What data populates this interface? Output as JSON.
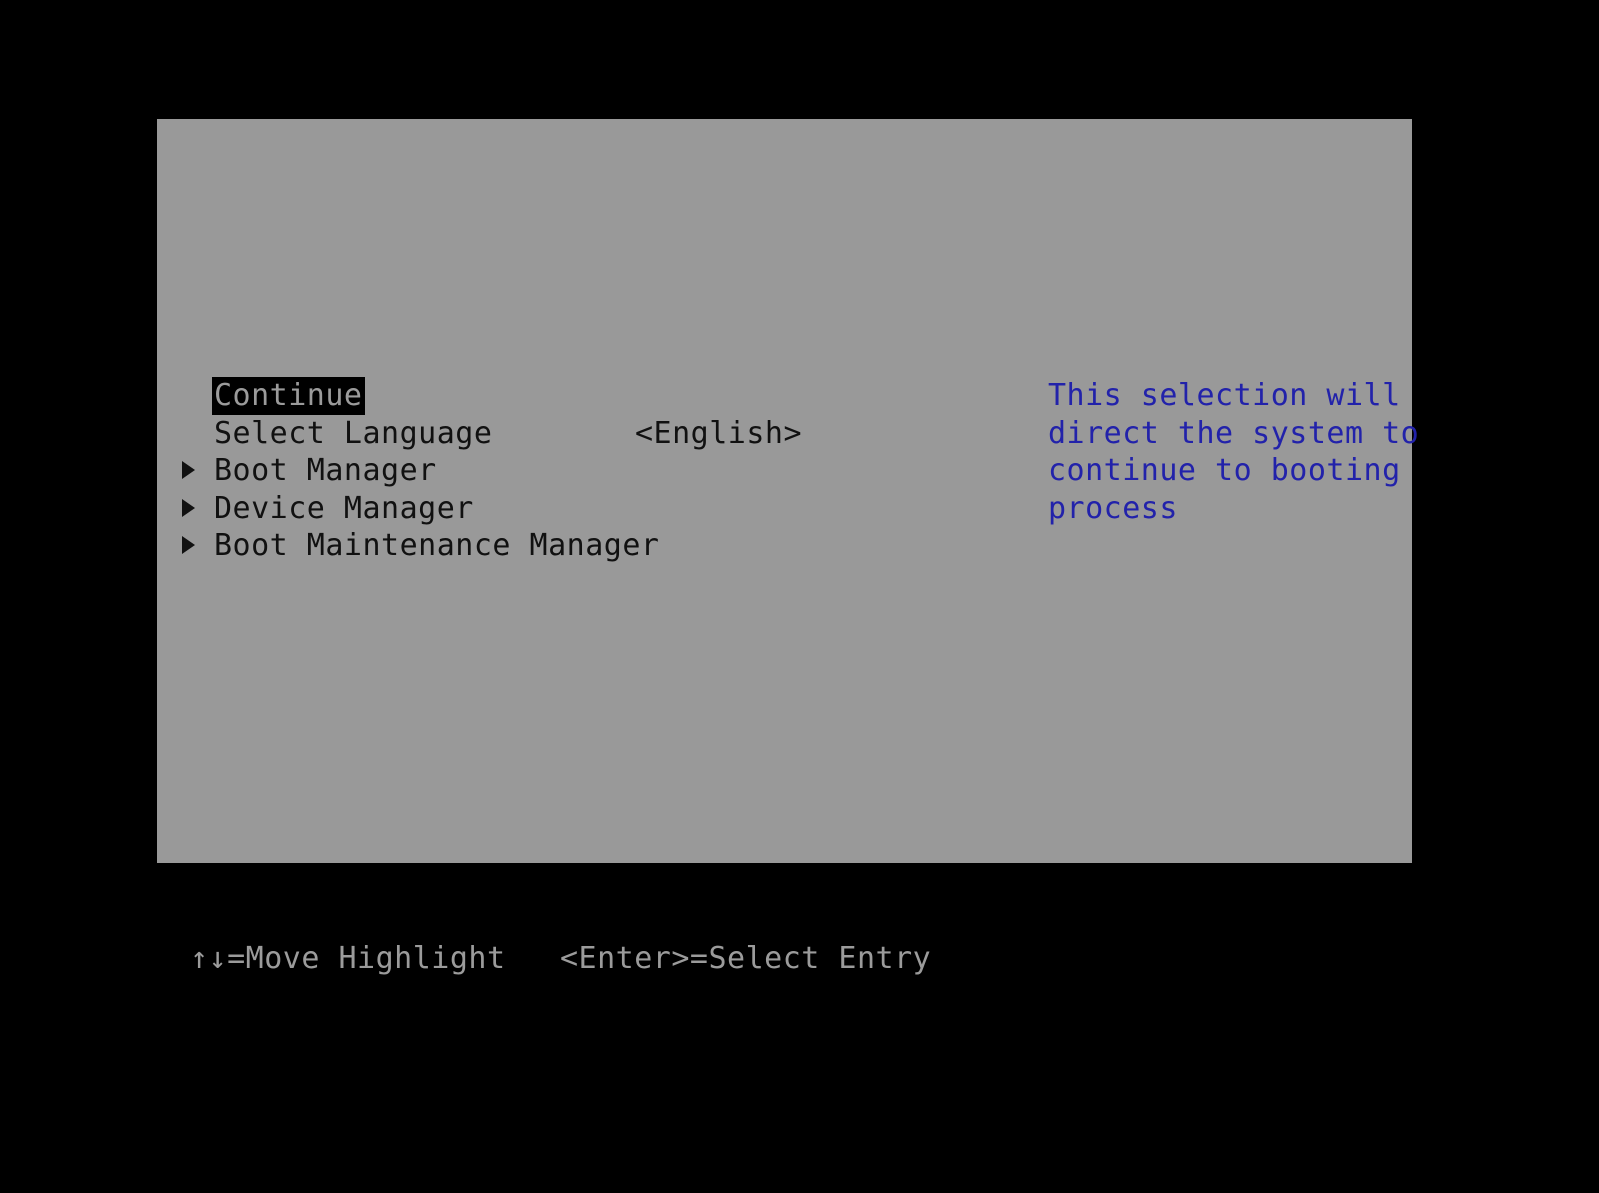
{
  "screen": {
    "kind": "uefi-setup-front-page",
    "background_color": "#000000",
    "panel_color": "#999999",
    "text_color": "#111111",
    "help_text_color": "#2222aa",
    "status_text_color": "#9b9b9b",
    "highlight_background": "#000000",
    "highlight_foreground": "#9b9b9b"
  },
  "menu": {
    "items": [
      {
        "label": "Continue",
        "value": "",
        "marker": "",
        "selected": true,
        "submenu": false
      },
      {
        "label": "Select Language",
        "value": "<English>",
        "marker": "",
        "selected": false,
        "submenu": false
      },
      {
        "label": "Boot Manager",
        "value": "",
        "marker": "submenu-triangle-icon",
        "selected": false,
        "submenu": true
      },
      {
        "label": "Device Manager",
        "value": "",
        "marker": "submenu-triangle-icon",
        "selected": false,
        "submenu": true
      },
      {
        "label": "Boot Maintenance Manager",
        "value": "",
        "marker": "submenu-triangle-icon",
        "selected": false,
        "submenu": true
      }
    ]
  },
  "help": {
    "lines": [
      "This selection will",
      "direct the system to",
      "continue to booting",
      "process"
    ]
  },
  "status_bar": {
    "items": [
      "↑↓=Move Highlight",
      "<Enter>=Select Entry"
    ]
  }
}
